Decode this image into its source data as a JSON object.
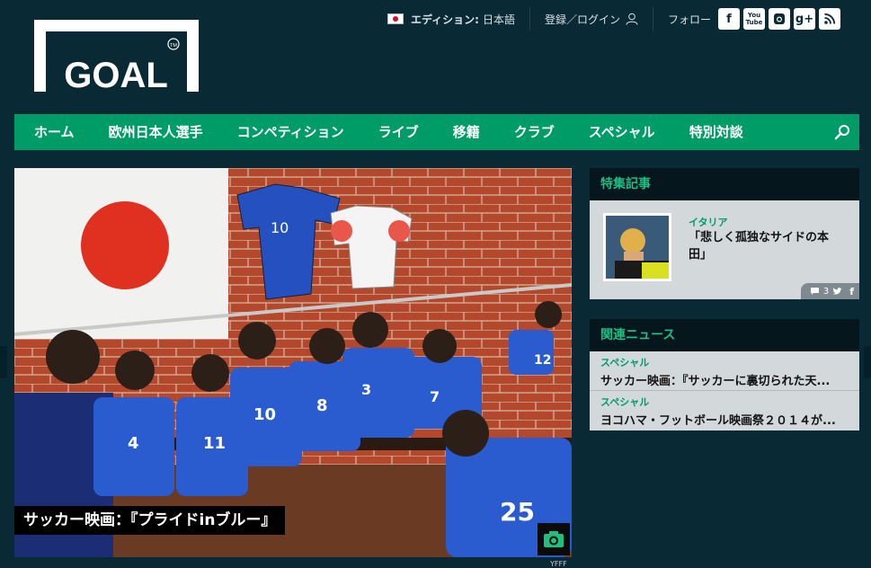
{
  "brand": {
    "logo_text": "GOAL",
    "trademark": "TM"
  },
  "topbar": {
    "edition_label": "エディション:",
    "edition_value": "日本語",
    "login_label": "登録／ログイン",
    "follow_label": "フォロー",
    "social": [
      "f",
      "You Tube",
      "instagram",
      "g+",
      "rss"
    ]
  },
  "nav": {
    "items": [
      "ホーム",
      "欧州日本人選手",
      "コンペティション",
      "ライブ",
      "移籍",
      "クラブ",
      "スペシャル",
      "特別対談"
    ]
  },
  "hero": {
    "caption": "サッカー映画：『プライドinブルー』",
    "credit": "YFFF",
    "jersey_numbers": [
      "10",
      "4",
      "11",
      "10",
      "8",
      "3",
      "7",
      "12",
      "25"
    ]
  },
  "feature": {
    "heading": "特集記事",
    "category": "イタリア",
    "title": "「悲しく孤独なサイドの本田」",
    "comment_count": "3"
  },
  "related": {
    "heading": "関連ニュース",
    "items": [
      {
        "category": "スペシャル",
        "title": "サッカー映画：『サッカーに裏切られた天..."
      },
      {
        "category": "スペシャル",
        "title": "ヨコハマ・フットボール映画祭２０１４が..."
      }
    ]
  },
  "colors": {
    "background": "#092a35",
    "accent": "#009c68",
    "panel": "#d3d8da"
  }
}
